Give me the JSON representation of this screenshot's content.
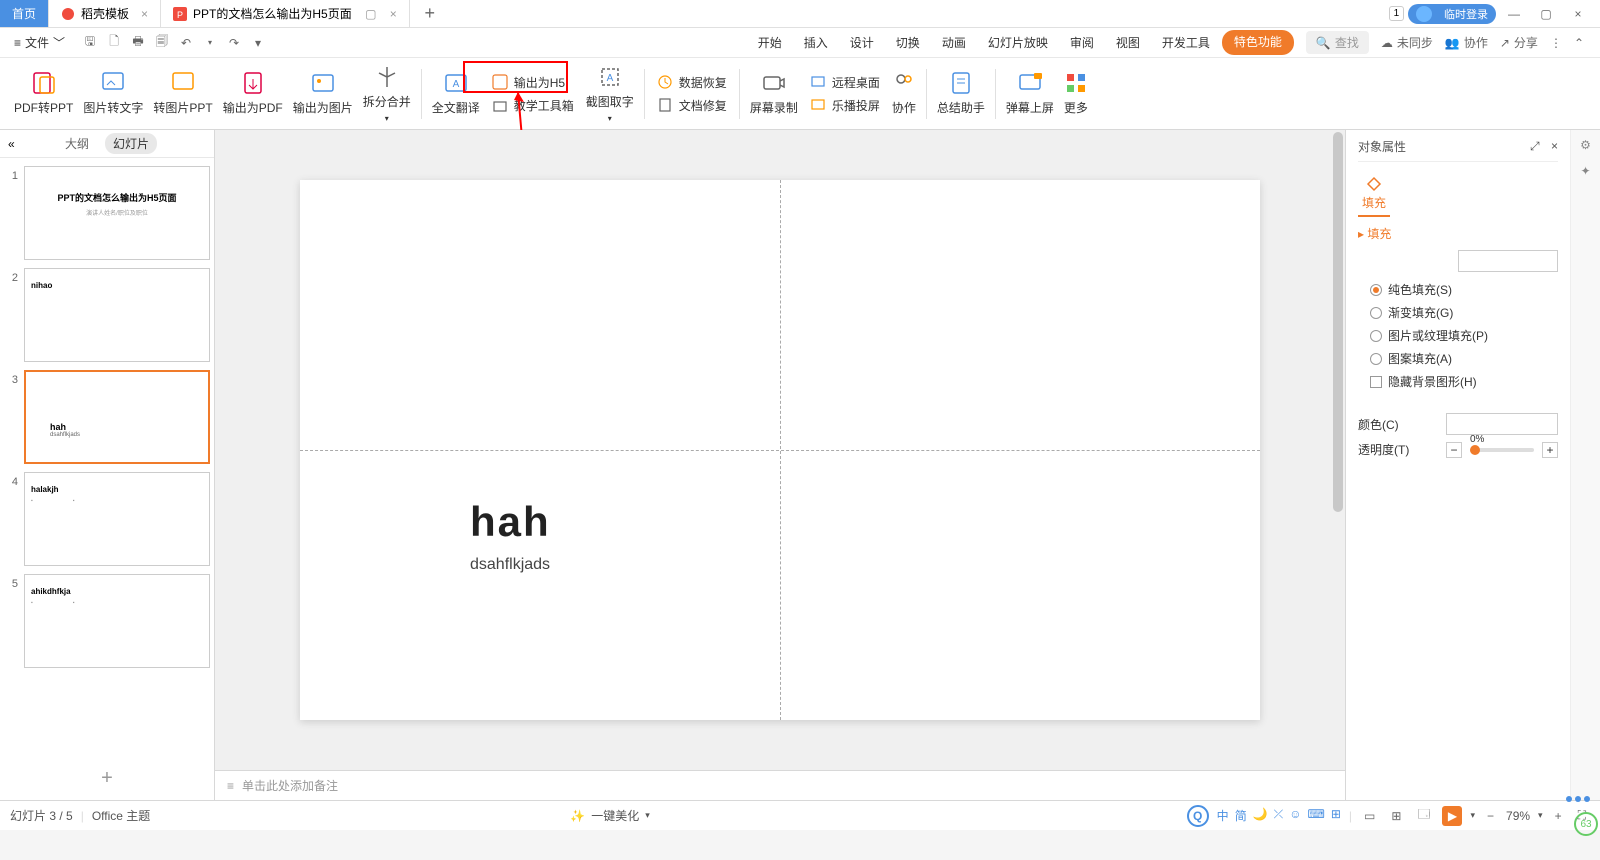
{
  "tabs": {
    "home": "首页",
    "docer": "稻壳模板",
    "current": "PPT的文档怎么输出为H5页面"
  },
  "title_right": {
    "badge_num": "1",
    "login": "临时登录"
  },
  "file_menu": "文件",
  "menu_tabs": [
    "开始",
    "插入",
    "设计",
    "切换",
    "动画",
    "幻灯片放映",
    "审阅",
    "视图",
    "开发工具"
  ],
  "feature_tab": "特色功能",
  "search_placeholder": "查找",
  "sync": {
    "unsynced": "未同步",
    "collab": "协作",
    "share": "分享"
  },
  "ribbon": {
    "pdf2ppt": "PDF转PPT",
    "pic2text": "图片转文字",
    "pic2ppt": "转图片PPT",
    "out_pdf": "输出为PDF",
    "out_pic": "输出为图片",
    "split_merge": "拆分合并",
    "fulltrans": "全文翻译",
    "out_h5": "输出为H5",
    "teachbox": "教学工具箱",
    "crop_text": "截图取字",
    "data_recover": "数据恢复",
    "doc_repair": "文档修复",
    "screen_rec": "屏幕录制",
    "remote": "远程桌面",
    "leboscreen": "乐播投屏",
    "collab": "协作",
    "summary": "总结助手",
    "barrage": "弹幕上屏",
    "more": "更多"
  },
  "thumb_panel": {
    "outline": "大纲",
    "slides": "幻灯片",
    "items": [
      {
        "num": "1",
        "title": "PPT的文档怎么输出为H5页面",
        "sub": "演讲人姓名/职位及职位"
      },
      {
        "num": "2",
        "title": "nihao",
        "sub": ""
      },
      {
        "num": "3",
        "title": "hah",
        "sub": "dsahflkjads"
      },
      {
        "num": "4",
        "title": "halakjh",
        "sub": ""
      },
      {
        "num": "5",
        "title": "ahikdhfkja",
        "sub": ""
      }
    ]
  },
  "slide_content": {
    "title": "hah",
    "subtitle": "dsahflkjads"
  },
  "notes_placeholder": "单击此处添加备注",
  "right_panel": {
    "header": "对象属性",
    "tab_fill": "填充",
    "section_fill": "填充",
    "fill_solid": "纯色填充(S)",
    "fill_gradient": "渐变填充(G)",
    "fill_picture": "图片或纹理填充(P)",
    "fill_pattern": "图案填充(A)",
    "hide_bg": "隐藏背景图形(H)",
    "color": "颜色(C)",
    "transparency": "透明度(T)",
    "trans_value": "0%"
  },
  "status": {
    "slide_pos": "幻灯片 3 / 5",
    "theme": "Office 主题",
    "beautify": "一键美化",
    "ime": [
      "中",
      "简"
    ],
    "zoom": "79%"
  }
}
